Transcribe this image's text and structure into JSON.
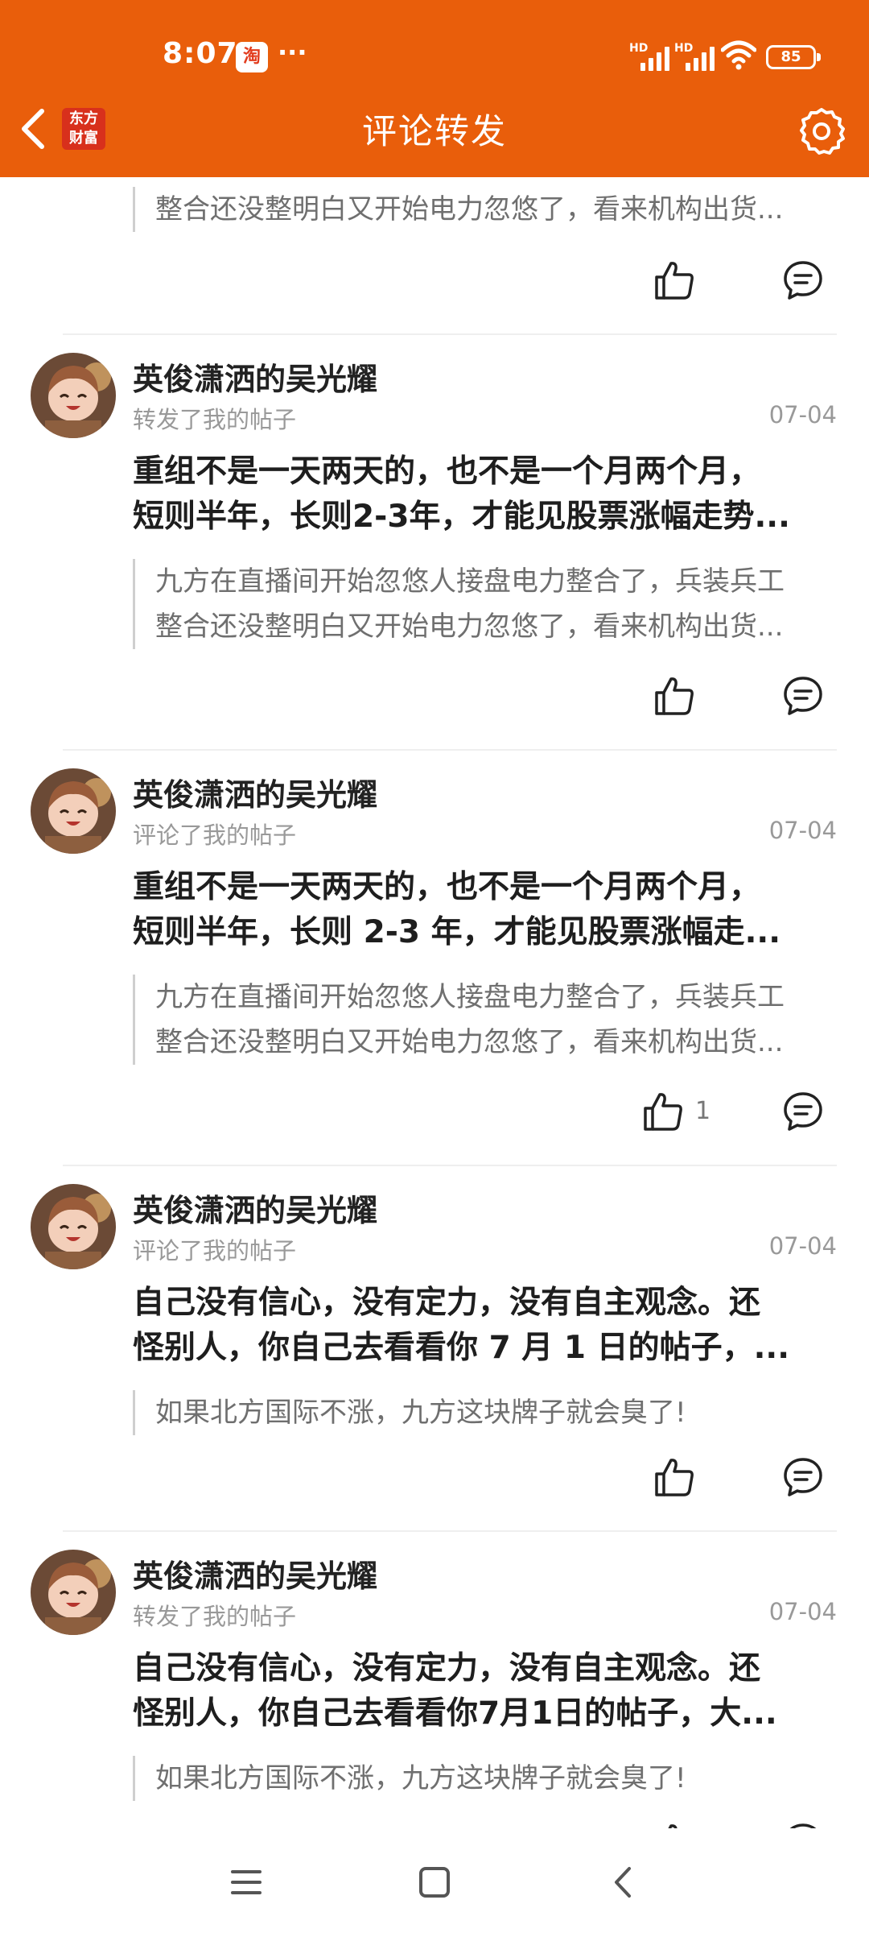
{
  "status_bar": {
    "time": "8:07",
    "app_badge": "淘",
    "more": "···",
    "signal_1": "HD",
    "signal_2": "HD",
    "battery": "85"
  },
  "header": {
    "title": "评论转发",
    "logo_line1": "东方",
    "logo_line2": "财富"
  },
  "colors": {
    "brand_orange": "#e95e0b",
    "logo_red": "#d8301c"
  },
  "top_fragment": {
    "quote_line": "整合还没整明白又开始电力忽悠了，看来机构出货..."
  },
  "items": [
    {
      "author": "英俊潇洒的吴光耀",
      "action": "转发了我的帖子",
      "date": "07-04",
      "body_line1": "重组不是一天两天的，也不是一个月两个月，",
      "body_line2": "短则半年，长则2-3年，才能见股票涨幅走势...",
      "quote_line1": "九方在直播间开始忽悠人接盘电力整合了，兵装兵工",
      "quote_line2": "整合还没整明白又开始电力忽悠了，看来机构出货...",
      "likes": ""
    },
    {
      "author": "英俊潇洒的吴光耀",
      "action": "评论了我的帖子",
      "date": "07-04",
      "body_line1": "重组不是一天两天的，也不是一个月两个月，",
      "body_line2": "短则半年，长则 2-3 年，才能见股票涨幅走...",
      "quote_line1": "九方在直播间开始忽悠人接盘电力整合了，兵装兵工",
      "quote_line2": "整合还没整明白又开始电力忽悠了，看来机构出货...",
      "likes": "1"
    },
    {
      "author": "英俊潇洒的吴光耀",
      "action": "评论了我的帖子",
      "date": "07-04",
      "body_line1": "自己没有信心，没有定力，没有自主观念。还",
      "body_line2": "怪别人，你自己去看看你 7 月 1 日的帖子，...",
      "quote_line1": "如果北方国际不涨，九方这块牌子就会臭了!",
      "likes": ""
    },
    {
      "author": "英俊潇洒的吴光耀",
      "action": "转发了我的帖子",
      "date": "07-04",
      "body_line1": "自己没有信心，没有定力，没有自主观念。还",
      "body_line2": "怪别人，你自己去看看你7月1日的帖子，大...",
      "quote_line1": "如果北方国际不涨，九方这块牌子就会臭了!",
      "likes": ""
    }
  ]
}
